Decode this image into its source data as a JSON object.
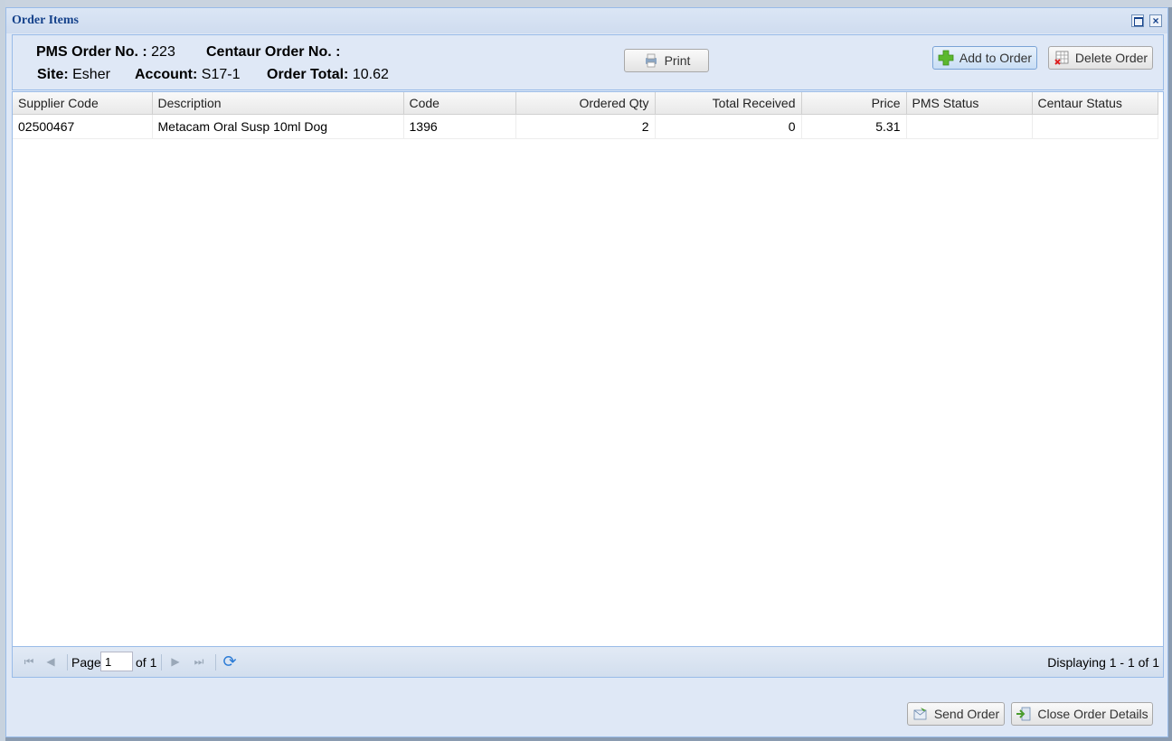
{
  "window": {
    "title": "Order Items"
  },
  "order": {
    "pms_label": "PMS Order No. :",
    "pms_value": "223",
    "centaur_label": "Centaur Order No. :",
    "centaur_value": "",
    "site_label": "Site:",
    "site_value": "Esher",
    "account_label": "Account:",
    "account_value": "S17-1",
    "total_label": "Order Total:",
    "total_value": "10.62"
  },
  "toolbar": {
    "print_label": "Print",
    "add_label": "Add to Order",
    "delete_label": "Delete Order"
  },
  "grid": {
    "columns": [
      "Supplier Code",
      "Description",
      "Code",
      "Ordered Qty",
      "Total Received",
      "Price",
      "PMS Status",
      "Centaur Status"
    ],
    "rows": [
      [
        "02500467",
        "Metacam Oral Susp 10ml Dog",
        "1396",
        "2",
        "0",
        "5.31",
        "",
        ""
      ]
    ]
  },
  "pager": {
    "page_label": "Page",
    "page_value": "1",
    "of_label": "of 1",
    "display_text": "Displaying 1 - 1 of 1"
  },
  "footer": {
    "send_label": "Send Order",
    "close_label": "Close Order Details"
  },
  "colors": {
    "title": "#15428b",
    "panel": "#dfe8f6",
    "border": "#99bbe8"
  },
  "icons": [
    "maximize-icon",
    "close-icon",
    "printer-icon",
    "plus-icon",
    "delete-grid-icon",
    "first-page-icon",
    "prev-page-icon",
    "next-page-icon",
    "last-page-icon",
    "refresh-icon",
    "send-icon",
    "close-details-icon"
  ]
}
